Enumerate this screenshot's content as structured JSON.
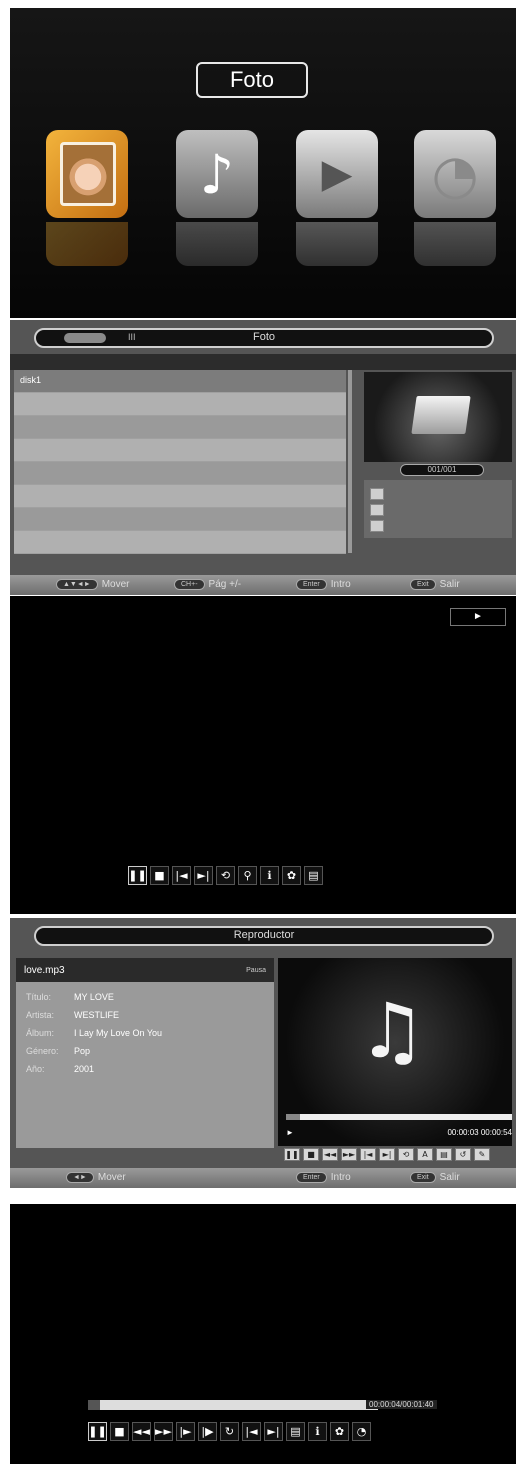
{
  "main_menu": {
    "title": "Foto",
    "icons": [
      "photo-icon",
      "music-icon",
      "video-icon",
      "settings-icon"
    ]
  },
  "browser": {
    "header": {
      "tab": "",
      "tab2": "III",
      "title": "Foto"
    },
    "files": [
      "disk1",
      "",
      "",
      "",
      "",
      "",
      "",
      ""
    ],
    "counter": "001/001",
    "hints": [
      {
        "key": "▲▼◄►",
        "label": "Mover"
      },
      {
        "key": "CH+-",
        "label": "Pág +/-"
      },
      {
        "key": "Enter",
        "label": "Intro"
      },
      {
        "key": "Exit",
        "label": "Salir"
      }
    ]
  },
  "photo_player": {
    "status": "►",
    "controls": [
      "pause-icon",
      "stop-icon",
      "prev-icon",
      "next-icon",
      "repeat-icon",
      "zoom-icon",
      "info-icon",
      "settings-icon",
      "playlist-icon"
    ],
    "glyphs": [
      "❚❚",
      "■",
      "|◄",
      "►|",
      "⟲",
      "⚲",
      "ℹ",
      "✿",
      "▤"
    ]
  },
  "music_player": {
    "header": {
      "title": "Reproductor"
    },
    "file": "love.mp3",
    "file_sub": "Pausa",
    "meta": [
      {
        "k": "Título:",
        "v": "MY LOVE"
      },
      {
        "k": "Artista:",
        "v": "WESTLIFE"
      },
      {
        "k": "Álbum:",
        "v": "I Lay My Love On You"
      },
      {
        "k": "Género:",
        "v": "Pop"
      },
      {
        "k": "Año:",
        "v": "2001"
      }
    ],
    "time": "00:00:03  00:00:54",
    "progress_fraction": 0.06,
    "controls": [
      "❚❚",
      "■",
      "◄◄",
      "►►",
      "|◄",
      "►|",
      "⟲",
      "A",
      "▤",
      "↺",
      "✎"
    ],
    "hints": [
      {
        "key": "◄►",
        "label": "Mover"
      },
      {
        "key": "Enter",
        "label": "Intro"
      },
      {
        "key": "Exit",
        "label": "Salir"
      }
    ]
  },
  "video_player": {
    "time": "00:00:04/00:01:40",
    "progress_fraction": 0.04,
    "controls": [
      "❚❚",
      "■",
      "◄◄",
      "►►",
      "|►",
      "|▶",
      "↻",
      "|◄",
      "►|",
      "▤",
      "ℹ",
      "✿",
      "◔"
    ]
  }
}
